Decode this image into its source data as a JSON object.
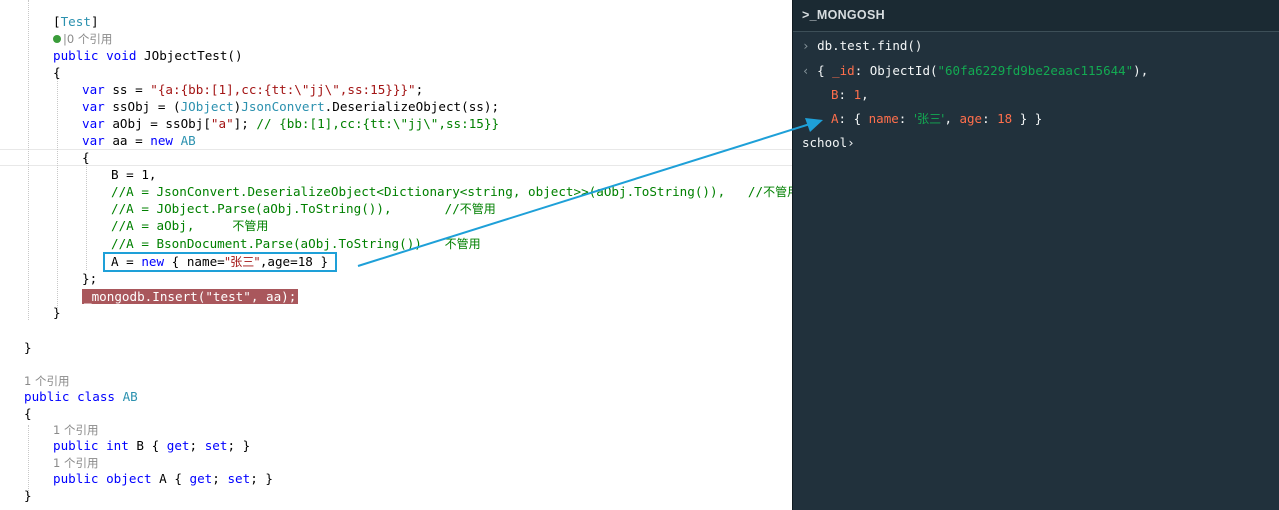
{
  "editor": {
    "attr_test_open": "[",
    "attr_test_name": "Test",
    "attr_test_close": "]",
    "test_ref_prefix": "|",
    "test_ref_count": "0 个引用",
    "method_kw1": "public",
    "method_kw2": "void",
    "method_name": "JObjectTest()",
    "brace_open": "{",
    "brace_close": "}",
    "var_kw": "var",
    "ss_decl": " ss = ",
    "ss_value": "\"{a:{bb:[1],cc:{tt:\\\"jj\\\",ss:15}}}\"",
    "semicolon": ";",
    "ssobj_decl": " ssObj = (",
    "jobject_type": "JObject",
    "ssobj_mid": ")",
    "jsonconvert_type": "JsonConvert",
    "ssobj_rest": ".DeserializeObject(ss);",
    "aobj_decl": " aObj = ssObj[",
    "aobj_key": "\"a\"",
    "aobj_close": "]; ",
    "aobj_comment": "// {bb:[1],cc:{tt:\\\"jj\\\",ss:15}}",
    "aa_decl": " aa = ",
    "new_kw": "new",
    "ab_type": " AB",
    "b_assign": "B = 1,",
    "comment1": "//A = JsonConvert.DeserializeObject<Dictionary<string, object>>(aObj.ToString()),   //",
    "comment1_cjk": "不管用",
    "comment2": "//A = JObject.Parse(aObj.ToString()),       //",
    "comment2_cjk": "不管用",
    "comment3": "//A = aObj,     ",
    "comment3_cjk": "不管用",
    "comment4": "//A = BsonDocument.Parse(aObj.ToString())   ",
    "comment4_cjk": "不管用",
    "a_assign_pre": "A = ",
    "a_assign_mid": " { name=",
    "a_assign_name": "\"张三\"",
    "a_assign_end": ",age=18 }",
    "closing_semicolon": "};",
    "insert_pre": "_mongodb.Insert(",
    "insert_str": "\"test\"",
    "insert_post": ", aa);",
    "class_ref": "1 个引用",
    "class_kw1": "public",
    "class_kw2": "class",
    "class_name": " AB",
    "prop_b_ref": "1 个引用",
    "prop_b_kw1": "public",
    "prop_b_kw2": "int",
    "prop_b_name": " B { ",
    "get_kw": "get",
    "set_kw": "set",
    "prop_b_mid": "; ",
    "prop_b_end": "; }",
    "prop_a_ref": "1 个引用",
    "prop_a_kw1": "public",
    "prop_a_kw2": "object",
    "prop_a_name": " A { "
  },
  "terminal": {
    "title": ">_MONGOSH",
    "prompt_symbol": "›",
    "command": "db.test.find()",
    "result_symbol": "‹",
    "open_brace": "{ ",
    "id_key": "_id",
    "colon": ": ",
    "objectid_fn": "ObjectId(",
    "objectid_value": "\"60fa6229fd9be2eaac115644\"",
    "objectid_close": "),",
    "b_key": "B",
    "b_value": "1",
    "comma": ",",
    "a_key": "A",
    "a_obj_open": "{ ",
    "name_key": "name",
    "name_value": "'张三'",
    "age_key": "age",
    "age_value": "18",
    "a_obj_close": " } }",
    "db_prompt": "school",
    "db_prompt_symbol": "›"
  },
  "colors": {
    "keyword": "#0000ff",
    "type": "#2b91af",
    "string": "#a31515",
    "comment": "#008000",
    "breakpoint_highlight": "#a9575c",
    "annotation_box": "#1ea0d8",
    "terminal_bg": "#21313c",
    "terminal_key": "#ff6f4c",
    "terminal_string": "#13aa52"
  }
}
